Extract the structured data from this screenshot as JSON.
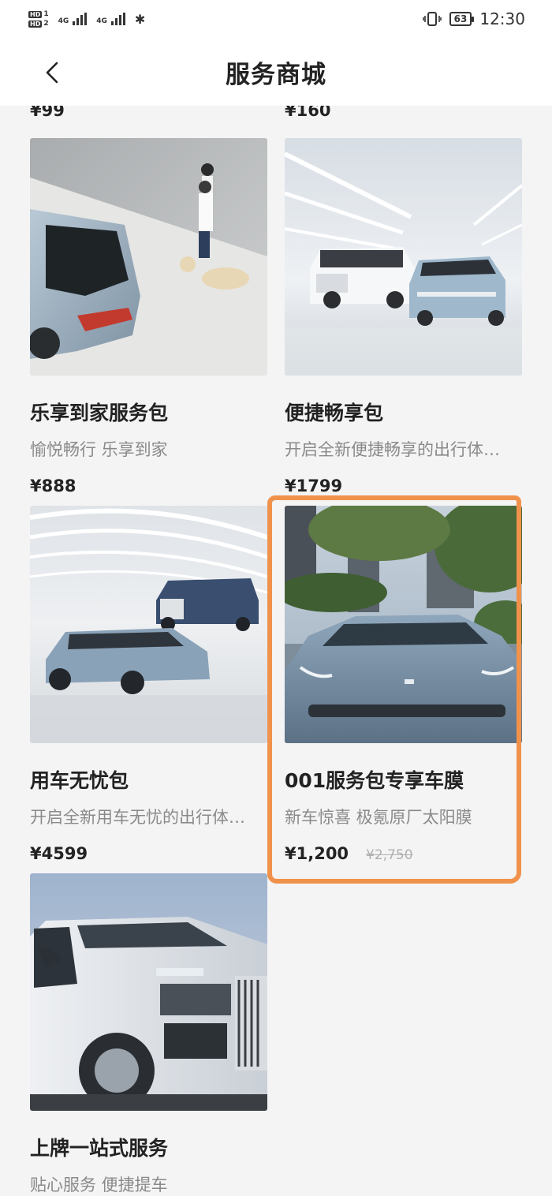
{
  "status_bar": {
    "hd1": "HD",
    "hd1_sub": "1",
    "hd2": "HD",
    "hd2_sub": "2",
    "signal1_label": "4G",
    "signal2_label": "4G",
    "battery": "63",
    "time": "12:30"
  },
  "header": {
    "title": "服务商城"
  },
  "top_prices": [
    "¥99",
    "¥160"
  ],
  "products": [
    {
      "title": "乐享到家服务包",
      "subtitle": "愉悦畅行 乐享到家",
      "price": "¥888",
      "image": "hatchback-and-family-with-dog"
    },
    {
      "title": "便捷畅享包",
      "subtitle": "开启全新便捷畅享的出行体…",
      "price": "¥1799",
      "image": "two-cars-white-studio"
    },
    {
      "title": "用车无忧包",
      "subtitle": "开启全新用车无忧的出行体…",
      "price": "¥4599",
      "image": "sedan-and-mpv-showroom"
    },
    {
      "title": "001服务包专享车膜",
      "subtitle": "新车惊喜 极氪原厂太阳膜",
      "price": "¥1,200",
      "original_price": "¥2,750",
      "image": "sports-car-front-trees"
    },
    {
      "title": "上牌一站式服务",
      "subtitle": "贴心服务 便捷提车",
      "price": "",
      "image": "mpv-front-closeup"
    }
  ],
  "colors": {
    "highlight": "#f0924b",
    "background": "#f4f4f4"
  }
}
